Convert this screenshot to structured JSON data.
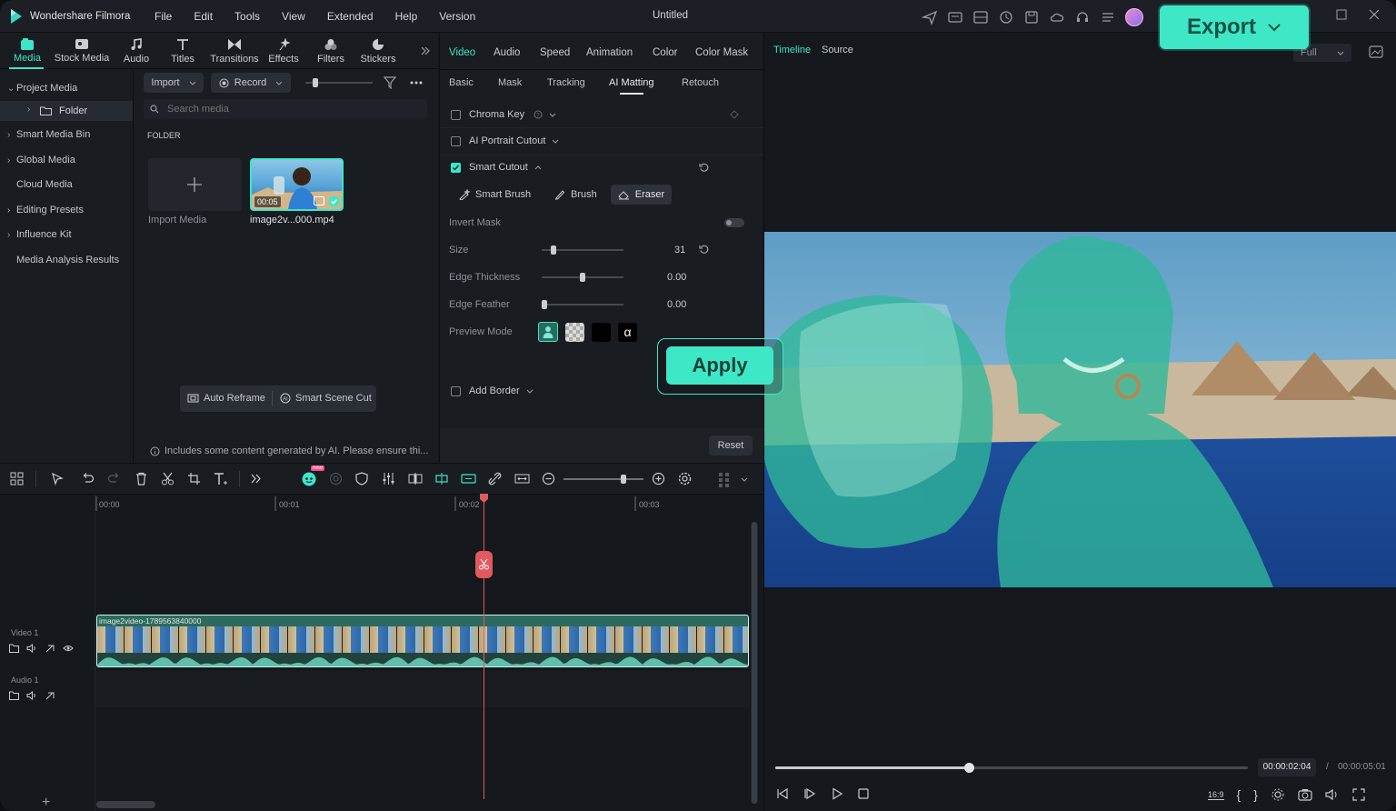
{
  "app": {
    "name": "Wondershare Filmora",
    "doc_title": "Untitled"
  },
  "menu": [
    "File",
    "Edit",
    "Tools",
    "View",
    "Extended",
    "Help",
    "Version"
  ],
  "export_label": "Export",
  "media_tabs": [
    "Media",
    "Stock Media",
    "Audio",
    "Titles",
    "Transitions",
    "Effects",
    "Filters",
    "Stickers"
  ],
  "sidebar": {
    "project_media": "Project Media",
    "folder": "Folder",
    "items": [
      "Smart Media Bin",
      "Global Media",
      "Cloud Media",
      "Editing Presets",
      "Influence Kit",
      "Media Analysis Results"
    ]
  },
  "media_toolbar": {
    "import": "Import",
    "record": "Record",
    "search_placeholder": "Search media"
  },
  "folder_heading": "FOLDER",
  "media_items": [
    {
      "label": "Import Media"
    },
    {
      "label": "image2v...000.mp4",
      "duration": "00:05"
    }
  ],
  "media_actions": {
    "auto_reframe": "Auto Reframe",
    "smart_scene_cut": "Smart Scene Cut"
  },
  "ai_notice": "Includes some content generated by AI. Please ensure thi...",
  "prop_tabs": [
    "Video",
    "Audio",
    "Speed",
    "Animation",
    "Color",
    "Color Mask"
  ],
  "prop_subtabs": [
    "Basic",
    "Mask",
    "Tracking",
    "AI Matting",
    "Retouch"
  ],
  "options": {
    "chroma_key": "Chroma Key",
    "portrait_cutout": "AI Portrait Cutout",
    "smart_cutout": "Smart Cutout",
    "smart_brush": "Smart Brush",
    "brush": "Brush",
    "eraser": "Eraser",
    "invert_mask": "Invert Mask",
    "size": "Size",
    "size_value": "31",
    "size_level": 0.12,
    "edge_thickness": "Edge Thickness",
    "edge_thickness_value": "0.00",
    "edge_thickness_level": 0.5,
    "edge_feather": "Edge Feather",
    "edge_feather_value": "0.00",
    "edge_feather_level": 0.0,
    "preview_mode": "Preview Mode",
    "add_border": "Add Border",
    "reset": "Reset"
  },
  "apply_label": "Apply",
  "preview": {
    "tabs": [
      "Timeline",
      "Source"
    ],
    "quality": "Full",
    "current_time": "00:00:02:04",
    "separator": "/",
    "total_time": "00:00:05:01",
    "progress": 0.41,
    "aspect": "16:9"
  },
  "timeline": {
    "ruler": [
      "00:00",
      "00:01",
      "00:02",
      "00:03"
    ],
    "video_track": "Video 1",
    "audio_track": "Audio 1",
    "clip_name": "image2video-1789563840000",
    "badge": "new"
  },
  "colors": {
    "accent": "#3ce6c8",
    "playhead": "#e05a5f",
    "clip": "#2c6a5d"
  }
}
